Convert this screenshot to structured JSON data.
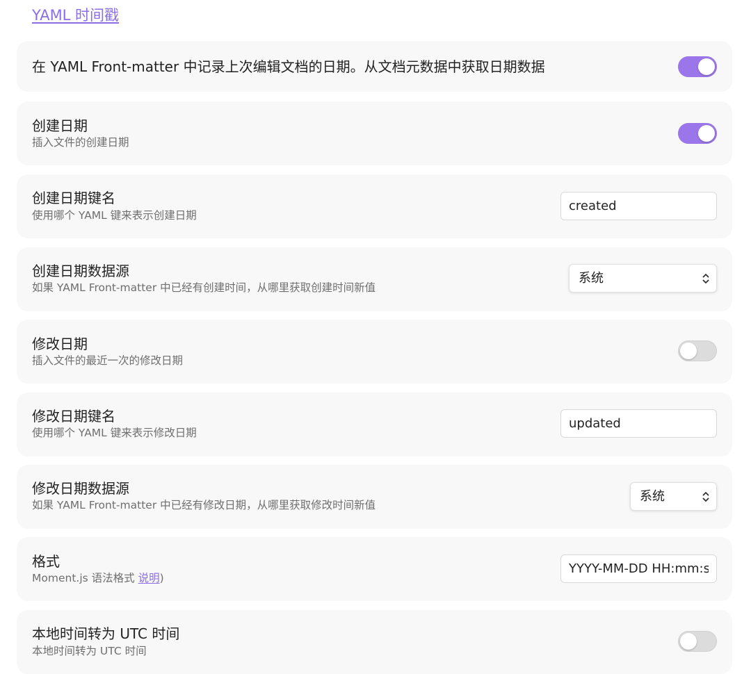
{
  "header": {
    "section_link": "YAML 时间戳"
  },
  "settings": {
    "enable": {
      "title": "在 YAML Front-matter 中记录上次编辑文档的日期。从文档元数据中获取日期数据",
      "state": "on"
    },
    "created_date": {
      "title": "创建日期",
      "description": "插入文件的创建日期",
      "state": "on"
    },
    "created_key": {
      "title": "创建日期键名",
      "description": "使用哪个 YAML 键来表示创建日期",
      "value": "created"
    },
    "created_source": {
      "title": "创建日期数据源",
      "description": "如果 YAML Front-matter 中已经有创建时间，从哪里获取创建时间新值",
      "selected": "系统"
    },
    "modified_date": {
      "title": "修改日期",
      "description": "插入文件的最近一次的修改日期",
      "state": "off"
    },
    "modified_key": {
      "title": "修改日期键名",
      "description": "使用哪个 YAML 键来表示修改日期",
      "value": "updated"
    },
    "modified_source": {
      "title": "修改日期数据源",
      "description": "如果 YAML Front-matter 中已经有修改日期，从哪里获取修改时间新值",
      "selected": "系统"
    },
    "format": {
      "title": "格式",
      "description_prefix": "Moment.js 语法格式 ",
      "description_link": "说明",
      "description_suffix": ")",
      "value": "YYYY-MM-DD HH:mm:ss"
    },
    "utc": {
      "title": "本地时间转为 UTC 时间",
      "description": "本地时间转为 UTC 时间",
      "state": "off"
    }
  },
  "colors": {
    "accent": "#9a76ea",
    "link": "#8b6ee6",
    "card_background": "#f8f8f8",
    "toggle_off": "#dcdcdc"
  },
  "icons": {
    "select_chevron": "chevron-up-down-icon"
  }
}
